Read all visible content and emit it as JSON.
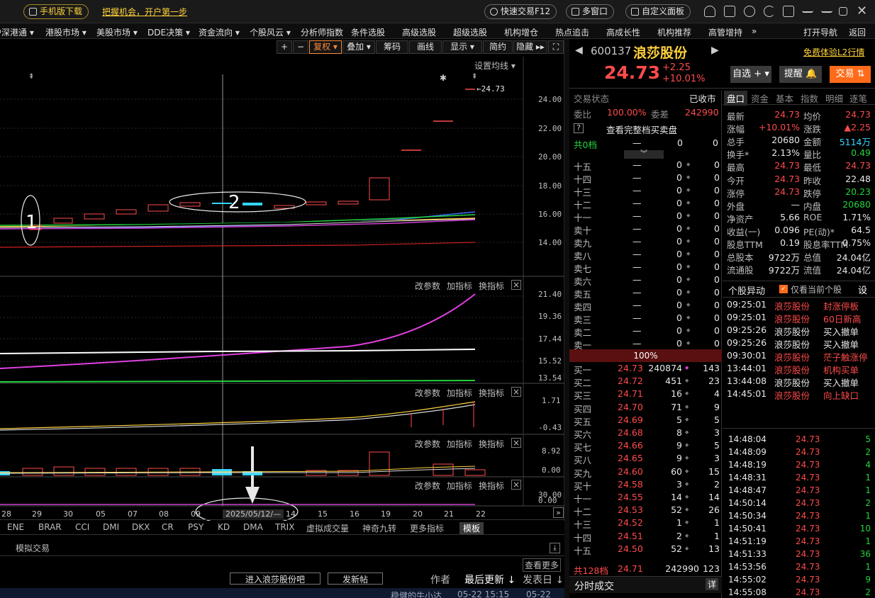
{
  "topbar": {
    "mobile_download": "手机版下载",
    "promo": "把握机会，开户第一步",
    "quick_trade": "快速交易F12",
    "multi_window": "多窗口",
    "custom_panel": "自定义面板"
  },
  "nav": {
    "items": [
      "沪深港通 ▾",
      "港股市场 ▾",
      "美股市场 ▾",
      "DDE决策 ▾",
      "资金流向 ▾",
      "个股风云 ▾",
      "分析师指数",
      "条件选股",
      "高级选股",
      "超级选股",
      "机构增仓",
      "热点追击",
      "高成长性",
      "机构推荐",
      "高管增持",
      "»"
    ],
    "open_nav": "打开导航",
    "back": "返回"
  },
  "chart_toolbar": {
    "plus": "+",
    "minus": "−",
    "fq": "复权",
    "overlay": "叠加",
    "chips": "筹码",
    "draw": "画线",
    "display": "显示",
    "simple": "简约",
    "hide": "隐藏 ▸▸",
    "fullscreen": "⛶",
    "ma_setting": "设置均线 ▾"
  },
  "main_chart": {
    "price_axis": [
      "24.00",
      "22.00",
      "20.00",
      "18.00",
      "16.00",
      "14.00"
    ],
    "price_marker": "←24.73",
    "annotation_1": "1",
    "annotation_2": "2"
  },
  "panels": {
    "tools": {
      "change_param": "改参数",
      "add_indicator": "加指标",
      "switch_indicator": "换指标",
      "close": "×"
    },
    "p1_axis": [
      "21.40",
      "19.36",
      "17.44",
      "15.52",
      "13.54"
    ],
    "p2_axis": [
      "1.71",
      "-0.43"
    ],
    "p3_axis": [
      "8.92",
      "0.00"
    ],
    "p4_axis": [
      "30.00",
      "0.00"
    ]
  },
  "x_axis": {
    "labels": [
      "28",
      "29",
      "30",
      "05",
      "07",
      "08",
      "09",
      "2025/05/12/—",
      "14",
      "15",
      "16",
      "19",
      "20",
      "21",
      "22"
    ],
    "more": "»"
  },
  "indicator_tabs": [
    "ENE",
    "BRAR",
    "CCI",
    "DMI",
    "DKX",
    "CR",
    "PSY",
    "KD",
    "DMA",
    "TRIX",
    "虚拟成交量",
    "神奇九转",
    "更多指标",
    "模板"
  ],
  "bottom": {
    "sim_trade": "模拟交易",
    "see_more": "查看更多",
    "enter_forum": "进入浪莎股份吧",
    "post": "发新帖",
    "author": "作者",
    "last_update": "最后更新 ↓",
    "post_date": "发表日 ↓",
    "post_row_author": "稳健的牛小达",
    "post_row_time": "05-22 15:15",
    "post_row_date": "05-22"
  },
  "stock": {
    "code": "600137",
    "name": "浪莎股份",
    "price": "24.73",
    "change": "+2.25",
    "pct": "+10.01%",
    "l2": "免费体验L2行情",
    "watch": "自选 + ▾",
    "alert": "提醒 🔔",
    "trade": "交易 ⇅",
    "status_label": "交易状态",
    "status": "已收市",
    "wb_label": "委比",
    "wb": "100.00%",
    "wc_label": "委差",
    "wc": "242990",
    "full_book": "查看完整档买卖盘",
    "sell_total_label": "共0档",
    "sell_total_a": "—",
    "sell_total_b": "0",
    "sell_total_c": "0"
  },
  "sell_book": [
    {
      "label": "十五",
      "price": "—",
      "vol": "0",
      "n": "0"
    },
    {
      "label": "十四",
      "price": "—",
      "vol": "0",
      "n": "0"
    },
    {
      "label": "十三",
      "price": "—",
      "vol": "0",
      "n": "0"
    },
    {
      "label": "十二",
      "price": "—",
      "vol": "0",
      "n": "0"
    },
    {
      "label": "十一",
      "price": "—",
      "vol": "0",
      "n": "0"
    },
    {
      "label": "卖十",
      "price": "—",
      "vol": "0",
      "n": "0"
    },
    {
      "label": "卖九",
      "price": "—",
      "vol": "0",
      "n": "0"
    },
    {
      "label": "卖八",
      "price": "—",
      "vol": "0",
      "n": "0"
    },
    {
      "label": "卖七",
      "price": "—",
      "vol": "0",
      "n": "0"
    },
    {
      "label": "卖六",
      "price": "—",
      "vol": "0",
      "n": "0"
    },
    {
      "label": "卖五",
      "price": "—",
      "vol": "0",
      "n": "0"
    },
    {
      "label": "卖四",
      "price": "—",
      "vol": "0",
      "n": "0"
    },
    {
      "label": "卖三",
      "price": "—",
      "vol": "0",
      "n": "0"
    },
    {
      "label": "卖二",
      "price": "—",
      "vol": "0",
      "n": "0"
    },
    {
      "label": "卖一",
      "price": "—",
      "vol": "0",
      "n": "0"
    }
  ],
  "book_ratio": "100%",
  "buy_book": [
    {
      "label": "买一",
      "price": "24.73",
      "vol": "240874",
      "n": "143"
    },
    {
      "label": "买二",
      "price": "24.72",
      "vol": "451",
      "n": "23"
    },
    {
      "label": "买三",
      "price": "24.71",
      "vol": "16",
      "n": "4"
    },
    {
      "label": "买四",
      "price": "24.70",
      "vol": "71",
      "n": "9"
    },
    {
      "label": "买五",
      "price": "24.69",
      "vol": "5",
      "n": "5"
    },
    {
      "label": "买六",
      "price": "24.68",
      "vol": "8",
      "n": "3"
    },
    {
      "label": "买七",
      "price": "24.66",
      "vol": "9",
      "n": "5"
    },
    {
      "label": "买八",
      "price": "24.65",
      "vol": "9",
      "n": "3"
    },
    {
      "label": "买九",
      "price": "24.60",
      "vol": "60",
      "n": "15"
    },
    {
      "label": "买十",
      "price": "24.58",
      "vol": "3",
      "n": "2"
    },
    {
      "label": "十一",
      "price": "24.55",
      "vol": "14",
      "n": "14"
    },
    {
      "label": "十二",
      "price": "24.53",
      "vol": "52",
      "n": "26"
    },
    {
      "label": "十三",
      "price": "24.52",
      "vol": "1",
      "n": "1"
    },
    {
      "label": "十四",
      "price": "24.51",
      "vol": "2",
      "n": "1"
    },
    {
      "label": "十五",
      "price": "24.50",
      "vol": "52",
      "n": "13"
    }
  ],
  "buy_total": {
    "label": "共128档",
    "price": "24.71",
    "vol": "242990",
    "n": "123"
  },
  "fenshi_title": "分时成交",
  "fenshi_detail": "详",
  "tabs": [
    "盘口",
    "资金",
    "基本",
    "指数",
    "明细",
    "逐笔"
  ],
  "fields": [
    {
      "l": "最新",
      "v": "24.73",
      "l2": "均价",
      "v2": "24.73"
    },
    {
      "l": "涨幅",
      "v": "+10.01%",
      "l2": "涨跌",
      "v2": "▲2.25"
    },
    {
      "l": "总手",
      "v": "20680",
      "l2": "金额",
      "v2": "5114万"
    },
    {
      "l": "换手*",
      "v": "2.13%",
      "l2": "量比",
      "v2": "0.49"
    },
    {
      "l": "最高",
      "v": "24.73",
      "l2": "最低",
      "v2": "24.73"
    },
    {
      "l": "今开",
      "v": "24.73",
      "l2": "昨收",
      "v2": "22.48"
    },
    {
      "l": "涨停",
      "v": "24.73",
      "l2": "跌停",
      "v2": "20.23"
    },
    {
      "l": "外盘",
      "v": "—",
      "l2": "内盘",
      "v2": "20680"
    },
    {
      "l": "净资产",
      "v": "5.66",
      "l2": "ROE",
      "v2": "1.71%"
    },
    {
      "l": "收益(一)",
      "v": "0.096",
      "l2": "PE(动)*",
      "v2": "64.5"
    },
    {
      "l": "股息TTM",
      "v": "0.19",
      "l2": "股息率TTM",
      "v2": "0.75%"
    },
    {
      "l": "总股本",
      "v": "9722万",
      "l2": "总值",
      "v2": "24.04亿"
    },
    {
      "l": "流通股",
      "v": "9722万",
      "l2": "流值",
      "v2": "24.04亿"
    }
  ],
  "events_header": {
    "title": "个股异动",
    "only_current": "仅看当前个股",
    "settings": "设"
  },
  "events": [
    {
      "t": "09:25:01",
      "n": "浪莎股份",
      "e": "封涨停板"
    },
    {
      "t": "09:25:01",
      "n": "浪莎股份",
      "e": "60日新高"
    },
    {
      "t": "09:25:26",
      "n": "浪莎股份",
      "e": "买入撤单"
    },
    {
      "t": "09:25:26",
      "n": "浪莎股份",
      "e": "买入撤单"
    },
    {
      "t": "09:30:01",
      "n": "浪莎股份",
      "e": "茫子触涨停"
    },
    {
      "t": "13:44:01",
      "n": "浪莎股份",
      "e": "机构买单"
    },
    {
      "t": "13:44:08",
      "n": "浪莎股份",
      "e": "买入撤单"
    },
    {
      "t": "14:45:01",
      "n": "浪莎股份",
      "e": "向上缺口"
    }
  ],
  "ticks": [
    {
      "t": "14:48:04",
      "p": "24.73",
      "v": "5"
    },
    {
      "t": "14:48:09",
      "p": "24.73",
      "v": "2"
    },
    {
      "t": "14:48:19",
      "p": "24.73",
      "v": "4"
    },
    {
      "t": "14:48:31",
      "p": "24.73",
      "v": "1"
    },
    {
      "t": "14:48:47",
      "p": "24.73",
      "v": "1"
    },
    {
      "t": "14:50:14",
      "p": "24.73",
      "v": "2"
    },
    {
      "t": "14:50:34",
      "p": "24.73",
      "v": "1"
    },
    {
      "t": "14:50:41",
      "p": "24.73",
      "v": "10"
    },
    {
      "t": "14:51:19",
      "p": "24.73",
      "v": "1"
    },
    {
      "t": "14:51:33",
      "p": "24.73",
      "v": "36"
    },
    {
      "t": "14:53:56",
      "p": "24.73",
      "v": "1"
    },
    {
      "t": "14:55:02",
      "p": "24.73",
      "v": "9"
    },
    {
      "t": "14:55:08",
      "p": "24.73",
      "v": "2"
    }
  ]
}
